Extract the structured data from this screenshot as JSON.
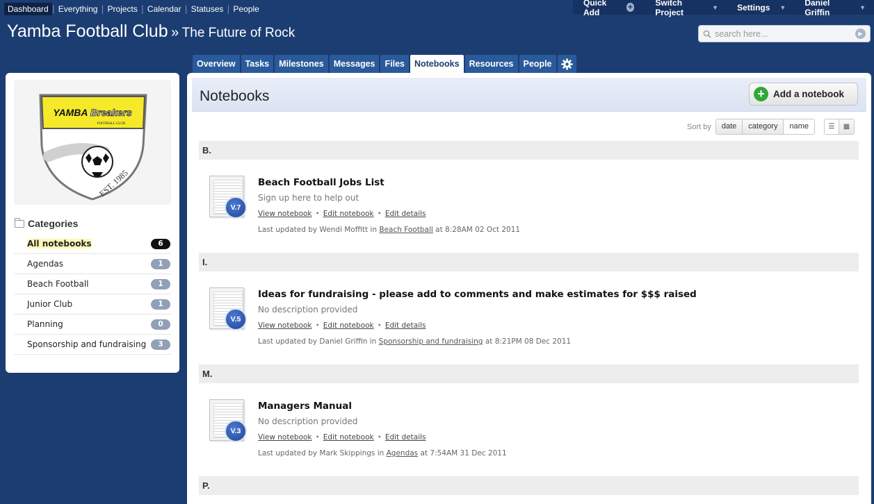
{
  "topnav": {
    "items": [
      "Dashboard",
      "Everything",
      "Projects",
      "Calendar",
      "Statuses",
      "People"
    ]
  },
  "userbar": {
    "quick_add": "Quick Add",
    "switch_project": "Switch Project",
    "settings": "Settings",
    "user": "Daniel Griffin"
  },
  "header": {
    "club": "Yamba Football Club",
    "sep": "»",
    "project": "The Future of Rock"
  },
  "search": {
    "placeholder": "search here..."
  },
  "tabs": [
    "Overview",
    "Tasks",
    "Milestones",
    "Messages",
    "Files",
    "Notebooks",
    "Resources",
    "People"
  ],
  "logo": {
    "brand_top": "YAMBA",
    "brand_script": "Breakers",
    "sub": "FOOTBALL CLUB",
    "est": "EST. 1985"
  },
  "sidebar": {
    "categories_title": "Categories",
    "categories": [
      {
        "name": "All notebooks",
        "count": "6"
      },
      {
        "name": "Agendas",
        "count": "1"
      },
      {
        "name": "Beach Football",
        "count": "1"
      },
      {
        "name": "Junior Club",
        "count": "1"
      },
      {
        "name": "Planning",
        "count": "0"
      },
      {
        "name": "Sponsorship and fundraising",
        "count": "3"
      }
    ]
  },
  "main": {
    "title": "Notebooks",
    "add_button": "Add a notebook",
    "sort_label": "Sort by",
    "sort_options": [
      "date",
      "category",
      "name"
    ],
    "groups": [
      {
        "letter": "B.",
        "notebook": {
          "version": "V.7",
          "title": "Beach Football Jobs List",
          "description": "Sign up here to help out",
          "links": [
            "View notebook",
            "Edit notebook",
            "Edit details"
          ],
          "updated_prefix": "Last updated by Wendi Moffitt in",
          "category": "Beach Football",
          "updated_suffix": "at 8:28AM 02 Oct 2011"
        }
      },
      {
        "letter": "I.",
        "notebook": {
          "version": "V.5",
          "title": "Ideas for fundraising - please add to comments and make estimates for $$$ raised",
          "description": "No description provided",
          "links": [
            "View notebook",
            "Edit notebook",
            "Edit details"
          ],
          "updated_prefix": "Last updated by Daniel Griffin in",
          "category": "Sponsorship and fundraising",
          "updated_suffix": "at 8:21PM 08 Dec 2011"
        }
      },
      {
        "letter": "M.",
        "notebook": {
          "version": "V.3",
          "title": "Managers Manual",
          "description": "No description provided",
          "links": [
            "View notebook",
            "Edit notebook",
            "Edit details"
          ],
          "updated_prefix": "Last updated by Mark Skippings in",
          "category": "Agendas",
          "updated_suffix": "at 7:54AM 31 Dec 2011"
        }
      },
      {
        "letter": "P."
      }
    ]
  }
}
